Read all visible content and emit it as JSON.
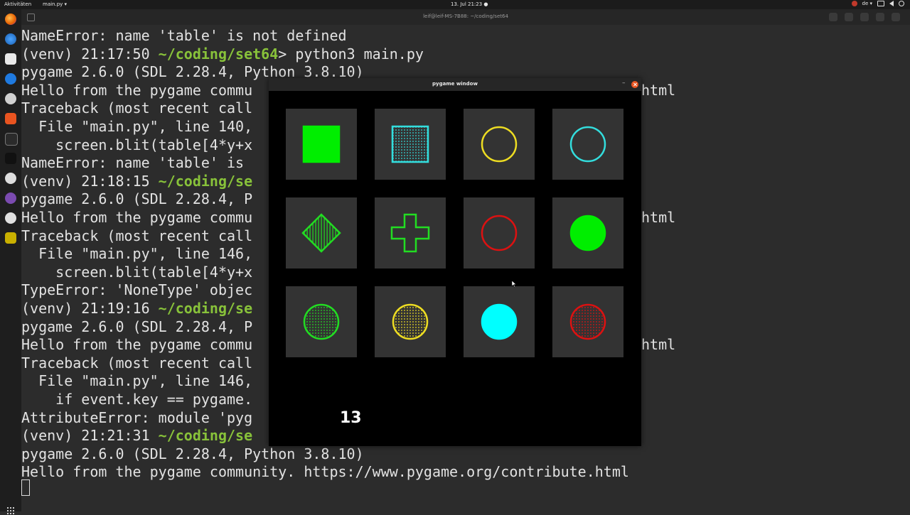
{
  "topbar": {
    "activities": "Aktivitäten",
    "app_menu": "main.py ▾",
    "clock": "13. Jul 21:23 ●",
    "lang": "de ▾"
  },
  "terminal": {
    "title": "leif@leif-MS-7B88: ~/coding/set64",
    "lines": [
      {
        "pre": "NameError: name 'table' is not defined",
        "path": "",
        "post": ""
      },
      {
        "pre": "(venv) 21:17:50 ",
        "path": "~/coding/set64",
        "post": "> python3 main.py"
      },
      {
        "pre": "pygame 2.6.0 (SDL 2.28.4, Python 3.8.10)",
        "path": "",
        "post": ""
      },
      {
        "pre": "Hello from the pygame commu",
        "path": "",
        "post": ""
      },
      {
        "pre": "Traceback (most recent call",
        "path": "",
        "post": ""
      },
      {
        "pre": "  File \"main.py\", line 140,",
        "path": "",
        "post": ""
      },
      {
        "pre": "    screen.blit(table[4*y+x",
        "path": "",
        "post": ""
      },
      {
        "pre": "NameError: name 'table' is",
        "path": "",
        "post": ""
      },
      {
        "pre": "(venv) 21:18:15 ",
        "path": "~/coding/se",
        "post": ""
      },
      {
        "pre": "pygame 2.6.0 (SDL 2.28.4, P",
        "path": "",
        "post": ""
      },
      {
        "pre": "Hello from the pygame commu",
        "path": "",
        "post": ""
      },
      {
        "pre": "Traceback (most recent call",
        "path": "",
        "post": ""
      },
      {
        "pre": "  File \"main.py\", line 146,",
        "path": "",
        "post": ""
      },
      {
        "pre": "    screen.blit(table[4*y+x",
        "path": "",
        "post": ""
      },
      {
        "pre": "TypeError: 'NoneType' objec",
        "path": "",
        "post": ""
      },
      {
        "pre": "(venv) 21:19:16 ",
        "path": "~/coding/se",
        "post": ""
      },
      {
        "pre": "pygame 2.6.0 (SDL 2.28.4, P",
        "path": "",
        "post": ""
      },
      {
        "pre": "Hello from the pygame commu",
        "path": "",
        "post": ""
      },
      {
        "pre": "Traceback (most recent call",
        "path": "",
        "post": ""
      },
      {
        "pre": "  File \"main.py\", line 146,",
        "path": "",
        "post": ""
      },
      {
        "pre": "    if event.key == pygame.",
        "path": "",
        "post": ""
      },
      {
        "pre": "AttributeError: module 'pyg",
        "path": "",
        "post": ""
      },
      {
        "pre": "(venv) 21:21:31 ",
        "path": "~/coding/se",
        "post": ""
      },
      {
        "pre": "pygame 2.6.0 (SDL 2.28.4, Python 3.8.10)",
        "path": "",
        "post": ""
      },
      {
        "pre": "Hello from the pygame community. https://www.pygame.org/contribute.html",
        "path": "",
        "post": ""
      }
    ],
    "right_fragments": [
      "html",
      "html",
      "html"
    ]
  },
  "pygame": {
    "title": "pygame window",
    "count": "13",
    "cards": [
      {
        "shape": "square",
        "fill": "solid",
        "color": "#00ee00"
      },
      {
        "shape": "square",
        "fill": "dotted",
        "color": "#33dddd"
      },
      {
        "shape": "circle",
        "fill": "outline",
        "color": "#eedd22"
      },
      {
        "shape": "circle",
        "fill": "outline",
        "color": "#33dddd"
      },
      {
        "shape": "diamond",
        "fill": "striped",
        "color": "#22dd22"
      },
      {
        "shape": "cross",
        "fill": "outline",
        "color": "#22dd22"
      },
      {
        "shape": "circle",
        "fill": "outline",
        "color": "#dd1111"
      },
      {
        "shape": "circle",
        "fill": "solid",
        "color": "#00ee00"
      },
      {
        "shape": "circle",
        "fill": "dotted",
        "color": "#22dd22"
      },
      {
        "shape": "circle",
        "fill": "dotted",
        "color": "#eedd22"
      },
      {
        "shape": "circle",
        "fill": "solid",
        "color": "#00ffff"
      },
      {
        "shape": "circle",
        "fill": "dotted",
        "color": "#dd1111"
      }
    ]
  },
  "dock_icons": [
    "firefox-icon",
    "thunderbird-icon",
    "files-icon",
    "help-icon",
    "settings-icon",
    "software-icon",
    "terminal-icon",
    "inkscape-icon",
    "obs-icon",
    "emacs-icon",
    "appimage-icon",
    "pygame-icon"
  ]
}
